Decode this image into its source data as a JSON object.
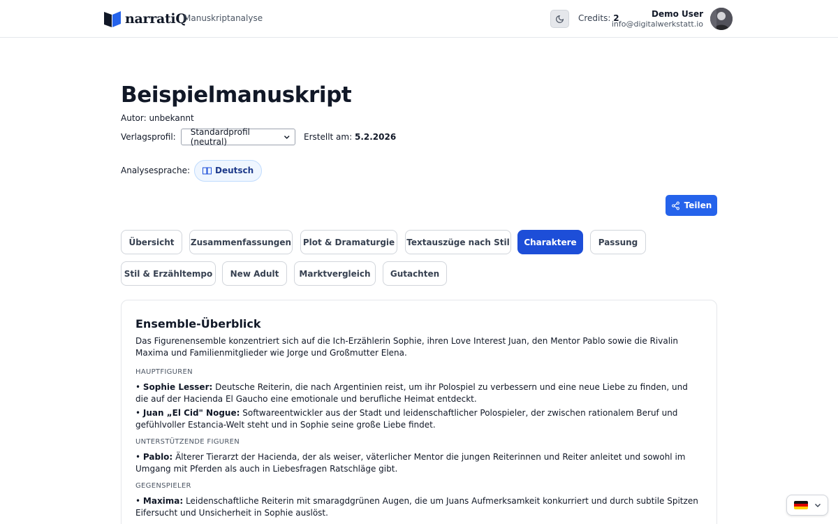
{
  "header": {
    "brand": "narratiQ",
    "subtitle": "Manuskriptanalyse",
    "credits_label": "Credits:",
    "credits_value": "2",
    "user_name": "Demo User",
    "user_email": "info@digitalwerkstatt.io",
    "theme_icon": "moon-icon"
  },
  "manuscript": {
    "title": "Beispielmanuskript",
    "author": "Autor: unbekannt",
    "profile_label": "Verlagsprofil:",
    "profile_value": "Standardprofil (neutral)",
    "created_label": "Erstellt am:",
    "created_value": "5.2.2026",
    "language_label": "Analysesprache:",
    "language_value": "Deutsch"
  },
  "share_label": "Teilen",
  "tabs": [
    {
      "label": "Übersicht"
    },
    {
      "label": "Zusammenfassungen"
    },
    {
      "label": "Plot & Dramaturgie"
    },
    {
      "label": "Textauszüge nach Stil"
    },
    {
      "label": "Charaktere",
      "active": true
    },
    {
      "label": "Passung"
    },
    {
      "label": "Stil & Erzähltempo"
    },
    {
      "label": "New Adult"
    },
    {
      "label": "Marktvergleich"
    },
    {
      "label": "Gutachten"
    }
  ],
  "card": {
    "title": "Ensemble-Überblick",
    "intro": "Das Figurenensemble konzentriert sich auf die Ich-Erzählerin Sophie, ihren Love Interest Juan, den Mentor Pablo sowie die Rivalin Maxima und Familienmitglieder wie Jorge und Großmutter Elena.",
    "sections": [
      {
        "heading": "Hauptfiguren",
        "entries": [
          {
            "name": "Sophie Lesser:",
            "text": "Deutsche Reiterin, die nach Argentinien reist, um ihr Polospiel zu verbessern und eine neue Liebe zu finden, und die auf der Hacienda El Gaucho eine emotionale und berufliche Heimat entdeckt."
          },
          {
            "name": "Juan „El Cid\" Nogue:",
            "text": "Softwareentwickler aus der Stadt und leidenschaftlicher Polospieler, der zwischen rationalem Beruf und gefühlvoller Estancia-Welt steht und in Sophie seine große Liebe findet."
          }
        ]
      },
      {
        "heading": "Unterstützende Figuren",
        "entries": [
          {
            "name": "Pablo:",
            "text": "Älterer Tierarzt der Hacienda, der als weiser, väterlicher Mentor die jungen Reiterinnen und Reiter anleitet und sowohl im Umgang mit Pferden als auch in Liebesfragen Ratschläge gibt."
          }
        ]
      },
      {
        "heading": "Gegenspieler",
        "entries": [
          {
            "name": "Maxima:",
            "text": "Leidenschaftliche Reiterin mit smaragdgrünen Augen, die um Juans Aufmerksamkeit konkurriert und durch subtile Spitzen Eifersucht und Unsicherheit in Sophie auslöst."
          }
        ]
      }
    ]
  },
  "bullet": "•",
  "colors": {
    "primary": "#2563eb",
    "active_tab": "#1d4ed8"
  }
}
